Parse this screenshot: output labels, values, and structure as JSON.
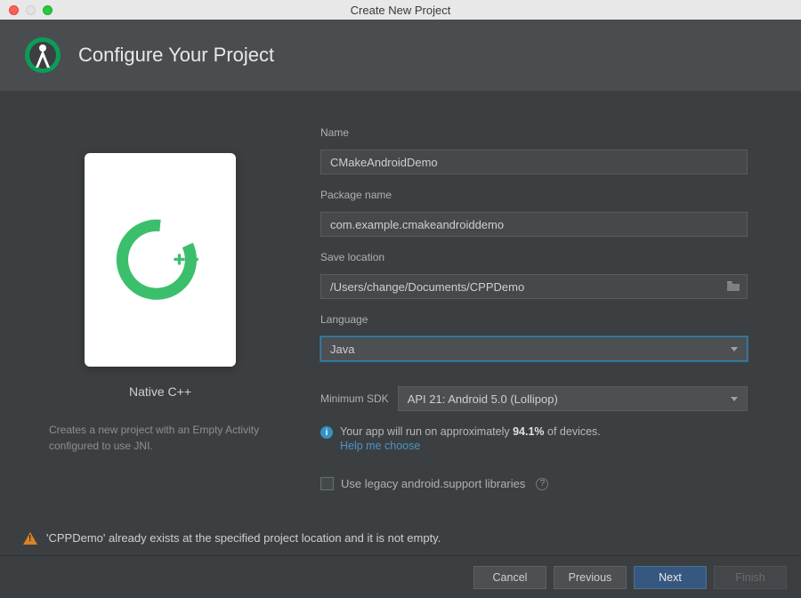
{
  "window": {
    "title": "Create New Project"
  },
  "header": {
    "title": "Configure Your Project"
  },
  "preview": {
    "title": "Native C++",
    "description": "Creates a new project with an Empty Activity configured to use JNI."
  },
  "form": {
    "name": {
      "label": "Name",
      "value": "CMakeAndroidDemo"
    },
    "package": {
      "label": "Package name",
      "value": "com.example.cmakeandroiddemo"
    },
    "location": {
      "label": "Save location",
      "value": "/Users/change/Documents/CPPDemo"
    },
    "language": {
      "label": "Language",
      "value": "Java"
    },
    "sdk": {
      "label": "Minimum SDK",
      "value": "API 21: Android 5.0 (Lollipop)",
      "info_prefix": "Your app will run on approximately ",
      "info_pct": "94.1%",
      "info_suffix": " of devices.",
      "help": "Help me choose"
    },
    "legacy": {
      "label": "Use legacy android.support libraries"
    }
  },
  "warning": "'CPPDemo' already exists at the specified project location and it is not empty.",
  "buttons": {
    "cancel": "Cancel",
    "previous": "Previous",
    "next": "Next",
    "finish": "Finish"
  }
}
